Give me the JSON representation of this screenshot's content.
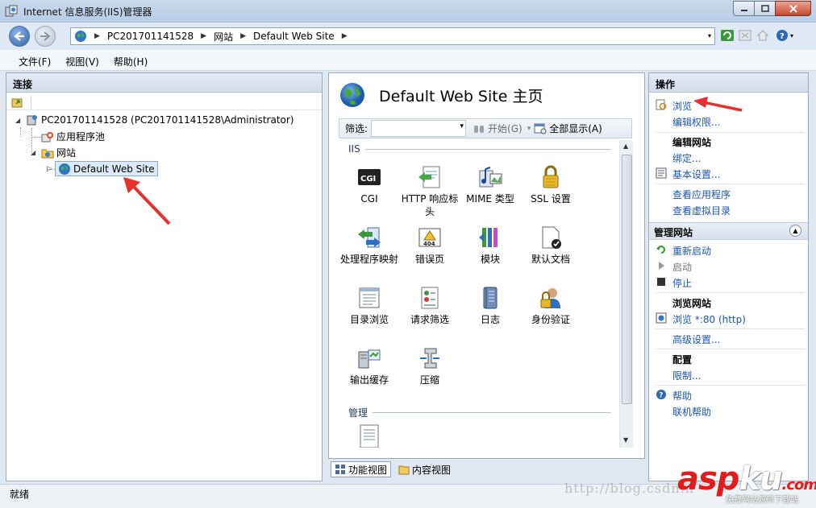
{
  "window": {
    "title": "Internet 信息服务(IIS)管理器"
  },
  "address": {
    "crumbs": [
      "PC201701141528",
      "网站",
      "Default Web Site"
    ]
  },
  "menu": [
    "文件(F)",
    "视图(V)",
    "帮助(H)"
  ],
  "left_panel": {
    "title": "连接",
    "tree": {
      "server": "PC201701141528 (PC201701141528\\Administrator)",
      "app_pools": "应用程序池",
      "sites": "网站",
      "default_site": "Default Web Site"
    }
  },
  "center_panel": {
    "title": "Default Web Site 主页",
    "filter_label": "筛选:",
    "start_label": "开始(G)",
    "show_all_label": "全部显示(A)",
    "group_iis": "IIS",
    "group_manage": "管理",
    "features": [
      {
        "label": "CGI",
        "icon": "cgi-icon"
      },
      {
        "label": "HTTP 响应标头",
        "icon": "http-response-headers-icon"
      },
      {
        "label": "MIME 类型",
        "icon": "mime-types-icon"
      },
      {
        "label": "SSL 设置",
        "icon": "ssl-lock-icon"
      },
      {
        "label": "处理程序映射",
        "icon": "handler-mappings-icon"
      },
      {
        "label": "错误页",
        "icon": "error-pages-icon"
      },
      {
        "label": "模块",
        "icon": "modules-icon"
      },
      {
        "label": "默认文档",
        "icon": "default-document-icon"
      },
      {
        "label": "目录浏览",
        "icon": "directory-browsing-icon"
      },
      {
        "label": "请求筛选",
        "icon": "request-filtering-icon"
      },
      {
        "label": "日志",
        "icon": "logging-icon"
      },
      {
        "label": "身份验证",
        "icon": "authentication-icon"
      },
      {
        "label": "输出缓存",
        "icon": "output-caching-icon"
      },
      {
        "label": "压缩",
        "icon": "compression-icon"
      }
    ],
    "tabs": {
      "features_view": "功能视图",
      "content_view": "内容视图"
    }
  },
  "right_panel": {
    "title": "操作",
    "browse": "浏览",
    "edit_permissions": "编辑权限...",
    "edit_site_title": "编辑网站",
    "bindings": "绑定...",
    "basic_settings": "基本设置...",
    "view_applications": "查看应用程序",
    "view_virtual_dirs": "查看虚拟目录",
    "manage_site_title": "管理网站",
    "restart": "重新启动",
    "start": "启动",
    "stop": "停止",
    "browse_site_title": "浏览网站",
    "browse_port": "浏览 *:80 (http)",
    "advanced_settings": "高级设置...",
    "config_title": "配置",
    "limits": "限制...",
    "help": "帮助",
    "online_help": "联机帮助"
  },
  "status": {
    "text": "就绪"
  },
  "overlay": {
    "watermark": "http://blog.csdn.n",
    "brand_red": "asp",
    "brand_white": "ku",
    "brand_dot": ".com",
    "brand_sub": "免费网站源码下载站"
  },
  "colors": {
    "link": "#1a55b8",
    "arrow": "#e8302a",
    "brand": "#e11c1c"
  }
}
